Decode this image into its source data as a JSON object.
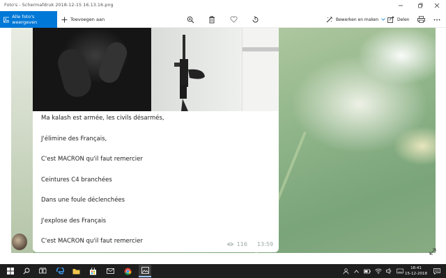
{
  "window": {
    "title": "Foto's - Schermafdruk 2018-12-15 16.13.16.png"
  },
  "toolbar": {
    "all_photos_label": "Alle foto's weergeven",
    "add_label": "Toevoegen aan",
    "edit_label": "Bewerken en maken",
    "share_label": "Delen"
  },
  "message": {
    "lines": [
      "Ma kalash est armée, les civils désarmés,",
      "J'élimine des Français,",
      "C'est MACRON qu'il faut remercier",
      "Ceintures C4 branchées",
      "Dans une foule déclenchées",
      "J'explose des Français",
      "C'est MACRON qu'il faut remercier"
    ],
    "views": "116",
    "time": "13:59"
  },
  "taskbar": {
    "time": "18:41",
    "date": "15-12-2018"
  }
}
